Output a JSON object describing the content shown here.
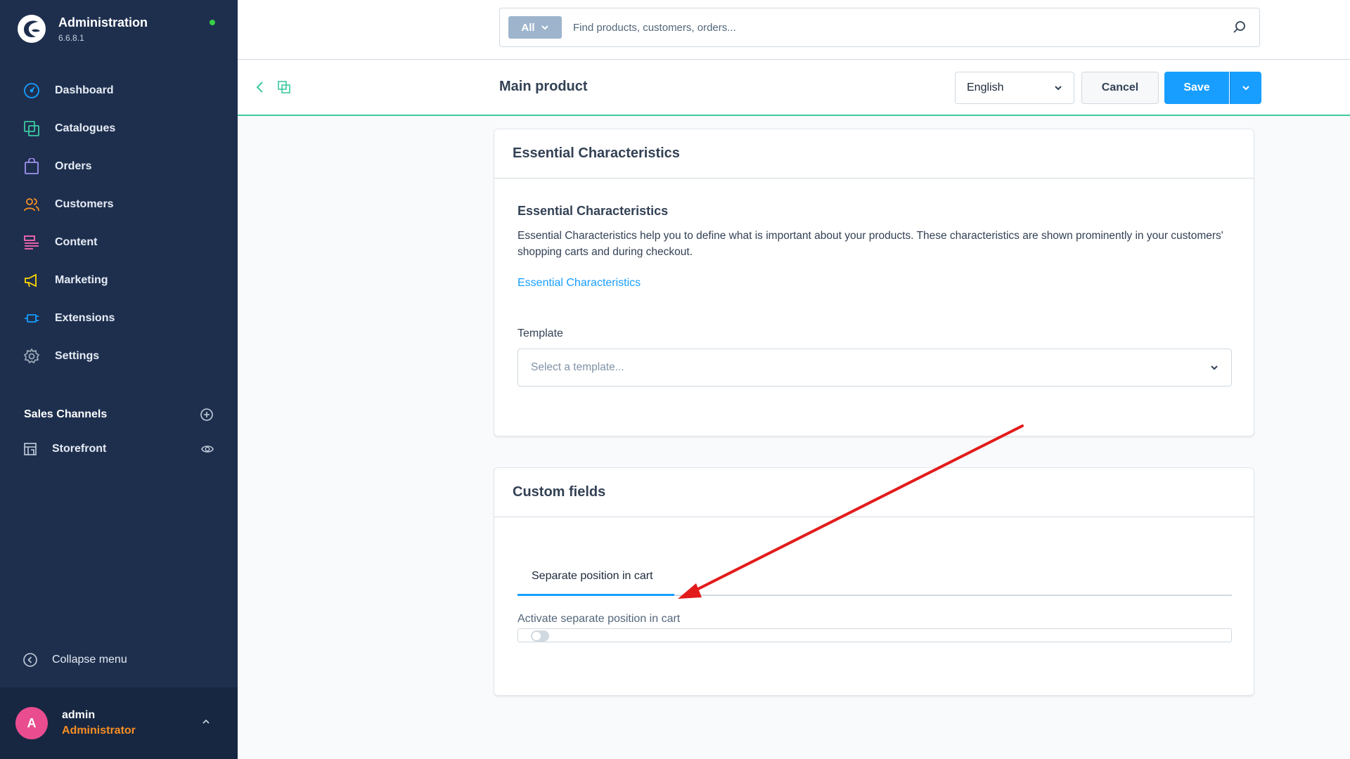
{
  "app": {
    "title": "Administration",
    "version": "6.6.8.1",
    "online_color": "#37d046"
  },
  "sidebar": {
    "items": [
      {
        "label": "Dashboard",
        "icon": "dashboard-icon",
        "color": "#189eff"
      },
      {
        "label": "Catalogues",
        "icon": "catalogues-icon",
        "color": "#3cc9a0"
      },
      {
        "label": "Orders",
        "icon": "orders-icon",
        "color": "#a092f0"
      },
      {
        "label": "Customers",
        "icon": "customers-icon",
        "color": "#f88f22"
      },
      {
        "label": "Content",
        "icon": "content-icon",
        "color": "#ff68b4"
      },
      {
        "label": "Marketing",
        "icon": "marketing-icon",
        "color": "#ffd700"
      },
      {
        "label": "Extensions",
        "icon": "extensions-icon",
        "color": "#189eff"
      },
      {
        "label": "Settings",
        "icon": "settings-icon",
        "color": "#9aa8b5"
      }
    ],
    "sales_channels_title": "Sales Channels",
    "sales_channels": [
      {
        "label": "Storefront",
        "icon": "storefront-icon"
      }
    ],
    "collapse_label": "Collapse menu"
  },
  "user": {
    "initial": "A",
    "name": "admin",
    "role": "Administrator"
  },
  "search": {
    "type_label": "All",
    "placeholder": "Find products, customers, orders..."
  },
  "header": {
    "title": "Main product",
    "language": "English",
    "cancel_label": "Cancel",
    "save_label": "Save"
  },
  "essential_card": {
    "header": "Essential Characteristics",
    "subtitle": "Essential Characteristics",
    "description": "Essential Characteristics help you to define what is important about your products. These characteristics are shown prominently in your customers' shopping carts and during checkout.",
    "link": "Essential Characteristics",
    "template_label": "Template",
    "template_placeholder": "Select a template..."
  },
  "custom_fields_card": {
    "header": "Custom fields",
    "tab_label": "Separate position in cart",
    "field_label": "Activate separate position in cart",
    "toggle_on": false
  },
  "annotation": {
    "arrow_color": "#e31b1b"
  }
}
